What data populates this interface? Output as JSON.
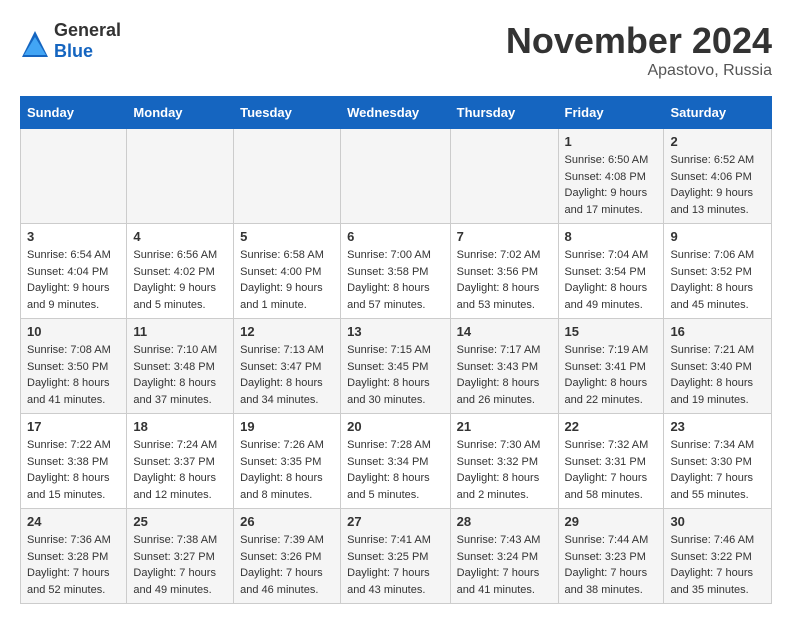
{
  "header": {
    "logo": {
      "general": "General",
      "blue": "Blue"
    },
    "title": "November 2024",
    "location": "Apastovo, Russia"
  },
  "weekdays": [
    "Sunday",
    "Monday",
    "Tuesday",
    "Wednesday",
    "Thursday",
    "Friday",
    "Saturday"
  ],
  "weeks": [
    [
      {
        "day": "",
        "sunrise": "",
        "sunset": "",
        "daylight": ""
      },
      {
        "day": "",
        "sunrise": "",
        "sunset": "",
        "daylight": ""
      },
      {
        "day": "",
        "sunrise": "",
        "sunset": "",
        "daylight": ""
      },
      {
        "day": "",
        "sunrise": "",
        "sunset": "",
        "daylight": ""
      },
      {
        "day": "",
        "sunrise": "",
        "sunset": "",
        "daylight": ""
      },
      {
        "day": "1",
        "sunrise": "Sunrise: 6:50 AM",
        "sunset": "Sunset: 4:08 PM",
        "daylight": "Daylight: 9 hours and 17 minutes."
      },
      {
        "day": "2",
        "sunrise": "Sunrise: 6:52 AM",
        "sunset": "Sunset: 4:06 PM",
        "daylight": "Daylight: 9 hours and 13 minutes."
      }
    ],
    [
      {
        "day": "3",
        "sunrise": "Sunrise: 6:54 AM",
        "sunset": "Sunset: 4:04 PM",
        "daylight": "Daylight: 9 hours and 9 minutes."
      },
      {
        "day": "4",
        "sunrise": "Sunrise: 6:56 AM",
        "sunset": "Sunset: 4:02 PM",
        "daylight": "Daylight: 9 hours and 5 minutes."
      },
      {
        "day": "5",
        "sunrise": "Sunrise: 6:58 AM",
        "sunset": "Sunset: 4:00 PM",
        "daylight": "Daylight: 9 hours and 1 minute."
      },
      {
        "day": "6",
        "sunrise": "Sunrise: 7:00 AM",
        "sunset": "Sunset: 3:58 PM",
        "daylight": "Daylight: 8 hours and 57 minutes."
      },
      {
        "day": "7",
        "sunrise": "Sunrise: 7:02 AM",
        "sunset": "Sunset: 3:56 PM",
        "daylight": "Daylight: 8 hours and 53 minutes."
      },
      {
        "day": "8",
        "sunrise": "Sunrise: 7:04 AM",
        "sunset": "Sunset: 3:54 PM",
        "daylight": "Daylight: 8 hours and 49 minutes."
      },
      {
        "day": "9",
        "sunrise": "Sunrise: 7:06 AM",
        "sunset": "Sunset: 3:52 PM",
        "daylight": "Daylight: 8 hours and 45 minutes."
      }
    ],
    [
      {
        "day": "10",
        "sunrise": "Sunrise: 7:08 AM",
        "sunset": "Sunset: 3:50 PM",
        "daylight": "Daylight: 8 hours and 41 minutes."
      },
      {
        "day": "11",
        "sunrise": "Sunrise: 7:10 AM",
        "sunset": "Sunset: 3:48 PM",
        "daylight": "Daylight: 8 hours and 37 minutes."
      },
      {
        "day": "12",
        "sunrise": "Sunrise: 7:13 AM",
        "sunset": "Sunset: 3:47 PM",
        "daylight": "Daylight: 8 hours and 34 minutes."
      },
      {
        "day": "13",
        "sunrise": "Sunrise: 7:15 AM",
        "sunset": "Sunset: 3:45 PM",
        "daylight": "Daylight: 8 hours and 30 minutes."
      },
      {
        "day": "14",
        "sunrise": "Sunrise: 7:17 AM",
        "sunset": "Sunset: 3:43 PM",
        "daylight": "Daylight: 8 hours and 26 minutes."
      },
      {
        "day": "15",
        "sunrise": "Sunrise: 7:19 AM",
        "sunset": "Sunset: 3:41 PM",
        "daylight": "Daylight: 8 hours and 22 minutes."
      },
      {
        "day": "16",
        "sunrise": "Sunrise: 7:21 AM",
        "sunset": "Sunset: 3:40 PM",
        "daylight": "Daylight: 8 hours and 19 minutes."
      }
    ],
    [
      {
        "day": "17",
        "sunrise": "Sunrise: 7:22 AM",
        "sunset": "Sunset: 3:38 PM",
        "daylight": "Daylight: 8 hours and 15 minutes."
      },
      {
        "day": "18",
        "sunrise": "Sunrise: 7:24 AM",
        "sunset": "Sunset: 3:37 PM",
        "daylight": "Daylight: 8 hours and 12 minutes."
      },
      {
        "day": "19",
        "sunrise": "Sunrise: 7:26 AM",
        "sunset": "Sunset: 3:35 PM",
        "daylight": "Daylight: 8 hours and 8 minutes."
      },
      {
        "day": "20",
        "sunrise": "Sunrise: 7:28 AM",
        "sunset": "Sunset: 3:34 PM",
        "daylight": "Daylight: 8 hours and 5 minutes."
      },
      {
        "day": "21",
        "sunrise": "Sunrise: 7:30 AM",
        "sunset": "Sunset: 3:32 PM",
        "daylight": "Daylight: 8 hours and 2 minutes."
      },
      {
        "day": "22",
        "sunrise": "Sunrise: 7:32 AM",
        "sunset": "Sunset: 3:31 PM",
        "daylight": "Daylight: 7 hours and 58 minutes."
      },
      {
        "day": "23",
        "sunrise": "Sunrise: 7:34 AM",
        "sunset": "Sunset: 3:30 PM",
        "daylight": "Daylight: 7 hours and 55 minutes."
      }
    ],
    [
      {
        "day": "24",
        "sunrise": "Sunrise: 7:36 AM",
        "sunset": "Sunset: 3:28 PM",
        "daylight": "Daylight: 7 hours and 52 minutes."
      },
      {
        "day": "25",
        "sunrise": "Sunrise: 7:38 AM",
        "sunset": "Sunset: 3:27 PM",
        "daylight": "Daylight: 7 hours and 49 minutes."
      },
      {
        "day": "26",
        "sunrise": "Sunrise: 7:39 AM",
        "sunset": "Sunset: 3:26 PM",
        "daylight": "Daylight: 7 hours and 46 minutes."
      },
      {
        "day": "27",
        "sunrise": "Sunrise: 7:41 AM",
        "sunset": "Sunset: 3:25 PM",
        "daylight": "Daylight: 7 hours and 43 minutes."
      },
      {
        "day": "28",
        "sunrise": "Sunrise: 7:43 AM",
        "sunset": "Sunset: 3:24 PM",
        "daylight": "Daylight: 7 hours and 41 minutes."
      },
      {
        "day": "29",
        "sunrise": "Sunrise: 7:44 AM",
        "sunset": "Sunset: 3:23 PM",
        "daylight": "Daylight: 7 hours and 38 minutes."
      },
      {
        "day": "30",
        "sunrise": "Sunrise: 7:46 AM",
        "sunset": "Sunset: 3:22 PM",
        "daylight": "Daylight: 7 hours and 35 minutes."
      }
    ]
  ]
}
